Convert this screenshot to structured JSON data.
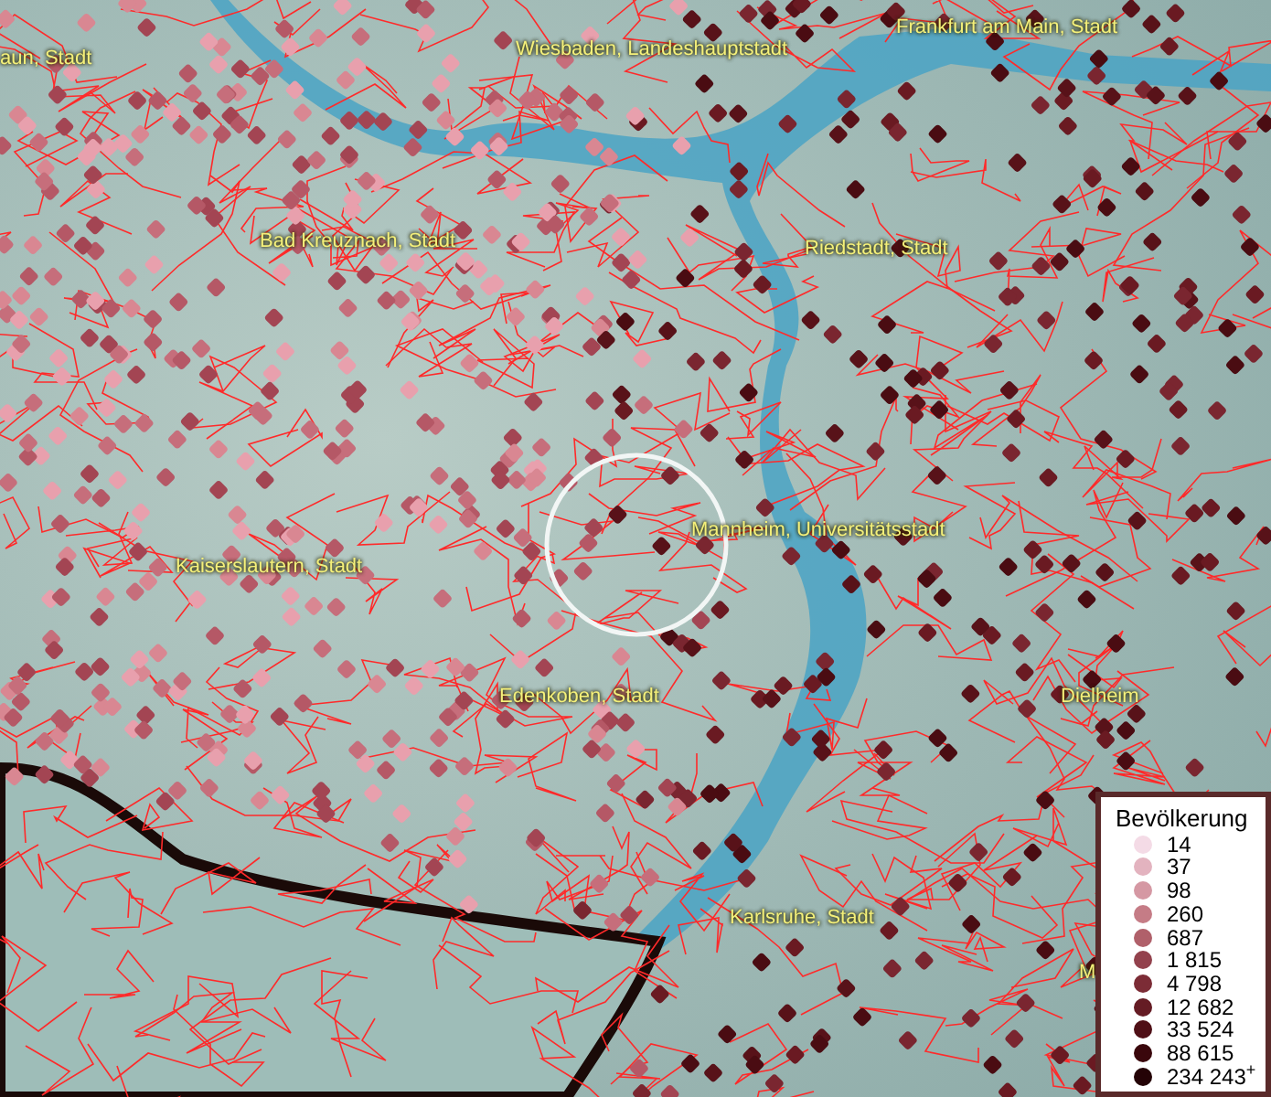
{
  "map": {
    "labels": [
      {
        "text": "aun, Stadt"
      },
      {
        "text": "Wiesbaden, Landeshauptstadt"
      },
      {
        "text": "Frankfurt am Main, Stadt"
      },
      {
        "text": "Bad Kreuznach, Stadt"
      },
      {
        "text": "Riedstadt, Stadt"
      },
      {
        "text": "Kaiserslautern, Stadt"
      },
      {
        "text": "Mannheim, Universitätsstadt"
      },
      {
        "text": "Edenkoben, Stadt"
      },
      {
        "text": "Dielheim"
      },
      {
        "text": "Karlsruhe, Stadt"
      },
      {
        "text": "M"
      }
    ]
  },
  "legend": {
    "title": "Bevölkerung",
    "items": [
      {
        "label": "14",
        "color": "#f4dbe6"
      },
      {
        "label": "37",
        "color": "#e3b3bf"
      },
      {
        "label": "98",
        "color": "#d598a3"
      },
      {
        "label": "260",
        "color": "#c57c86"
      },
      {
        "label": "687",
        "color": "#b0606a"
      },
      {
        "label": "1 815",
        "color": "#93424d"
      },
      {
        "label": "4 798",
        "color": "#7c2c36"
      },
      {
        "label": "12 682",
        "color": "#651c24"
      },
      {
        "label": "33 524",
        "color": "#4f0f16"
      },
      {
        "label": "88 615",
        "color": "#3a070c"
      },
      {
        "label": "234 243$^{+}$",
        "color": "#240306"
      }
    ]
  }
}
